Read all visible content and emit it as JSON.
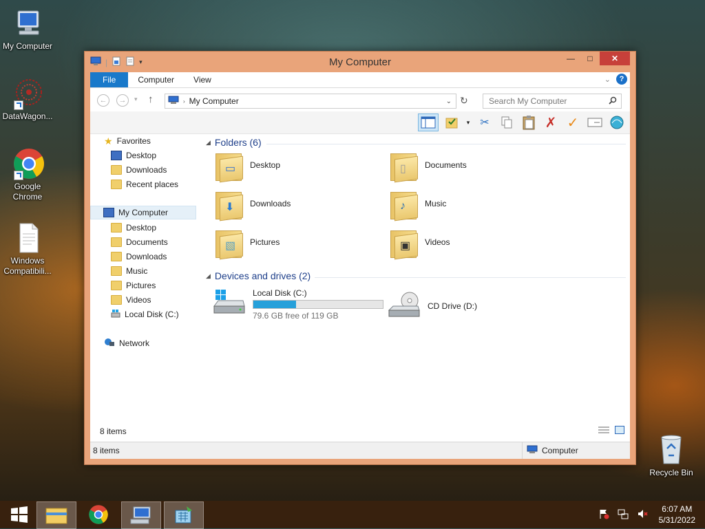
{
  "desktop": {
    "icons": [
      {
        "label": "My Computer"
      },
      {
        "label": "DataWagon..."
      },
      {
        "label": "Google Chrome"
      },
      {
        "label": "Windows Compatibili..."
      },
      {
        "label": "Recycle Bin"
      }
    ]
  },
  "window": {
    "title": "My Computer",
    "controls": {
      "minimize": "—",
      "maximize": "□",
      "close": "✕"
    },
    "ribbon": {
      "tabs": [
        "File",
        "Computer",
        "View"
      ],
      "help": "?"
    },
    "address": {
      "icon": "computer-icon",
      "path": "My Computer"
    },
    "search": {
      "placeholder": "Search My Computer"
    },
    "nav": {
      "favorites": {
        "label": "Favorites",
        "items": [
          "Desktop",
          "Downloads",
          "Recent places"
        ]
      },
      "computer": {
        "label": "My Computer",
        "items": [
          "Desktop",
          "Documents",
          "Downloads",
          "Music",
          "Pictures",
          "Videos",
          "Local Disk (C:)"
        ]
      },
      "network": {
        "label": "Network"
      }
    },
    "folders_group": {
      "title": "Folders (6)",
      "items": [
        "Desktop",
        "Documents",
        "Downloads",
        "Music",
        "Pictures",
        "Videos"
      ]
    },
    "drives_group": {
      "title": "Devices and drives (2)",
      "local_disk": {
        "name": "Local Disk (C:)",
        "space": "79.6 GB free of 119 GB",
        "used_fraction": 0.331
      },
      "cd_drive": {
        "name": "CD Drive (D:)"
      }
    },
    "item_count": "8 items",
    "status": {
      "left": "8 items",
      "right": "Computer"
    }
  },
  "taskbar": {
    "time": "6:07 AM",
    "date": "5/31/2022"
  },
  "colors": {
    "accent": "#1979ca",
    "window_frame": "#e9a47a",
    "close": "#c7403a",
    "disk_fill": "#26a0da"
  }
}
